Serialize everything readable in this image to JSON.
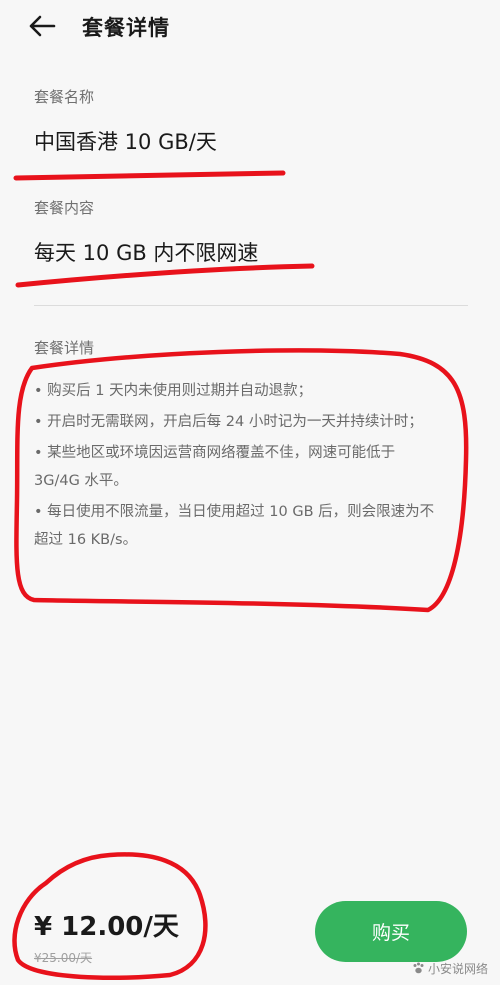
{
  "header": {
    "title": "套餐详情",
    "back_icon": "arrow-left-icon"
  },
  "plan_name": {
    "label": "套餐名称",
    "value": "中国香港 10 GB/天"
  },
  "plan_content": {
    "label": "套餐内容",
    "value": "每天 10 GB 内不限网速"
  },
  "plan_details": {
    "label": "套餐详情",
    "items": [
      "• 购买后 1 天内未使用则过期并自动退款；",
      "• 开启时无需联网，开启后每 24 小时记为一天并持续计时；",
      "• 某些地区或环境因运营商网络覆盖不佳，网速可能低于 3G/4G 水平。",
      "• 每日使用不限流量，当日使用超过 10 GB 后，则会限速为不超过 16 KB/s。"
    ]
  },
  "footer": {
    "price": "¥ 12.00/天",
    "original_price": "¥25.00/天",
    "buy_label": "购买"
  },
  "watermark": {
    "text": "小安说网络"
  },
  "colors": {
    "accent_green": "#35b45e",
    "annotation_red": "#e8121b",
    "background": "#f7f7f7"
  }
}
